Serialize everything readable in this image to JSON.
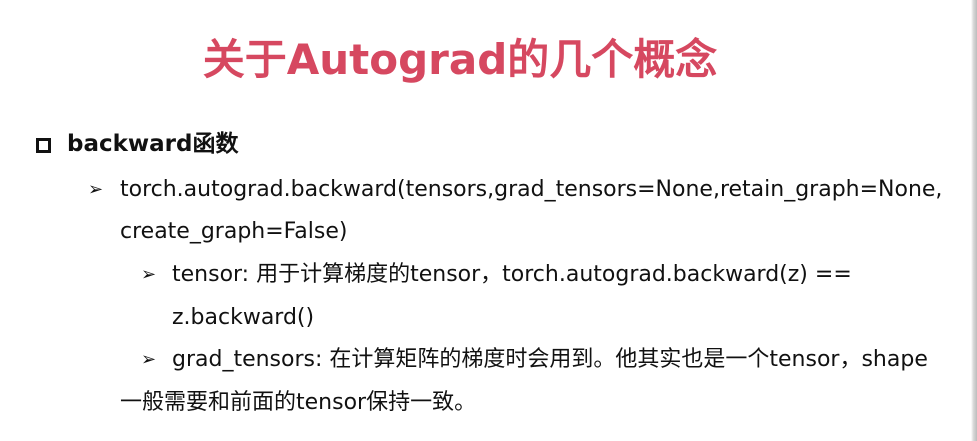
{
  "slide": {
    "title": "关于Autograd的几个概念",
    "section": {
      "bullet_icon": "hollow-square-bullet-icon",
      "label": "backward函数"
    },
    "items": [
      {
        "bullet_icon": "arrow-bullet-icon",
        "line1": "torch.autograd.backward(tensors,grad_tensors=None,retain_graph=None,",
        "line2": "create_graph=False)"
      },
      {
        "bullet_icon": "arrow-bullet-icon",
        "line1": "tensor: 用于计算梯度的tensor，torch.autograd.backward(z) ==",
        "line2": "z.backward()"
      },
      {
        "bullet_icon": "arrow-bullet-icon",
        "line1": "grad_tensors: 在计算矩阵的梯度时会用到。他其实也是一个tensor，shape",
        "line2": "一般需要和前面的tensor保持一致。"
      }
    ],
    "arrow_glyph": "➢",
    "colors": {
      "title": "#d64860",
      "text": "#111111",
      "background": "#ffffff"
    }
  }
}
